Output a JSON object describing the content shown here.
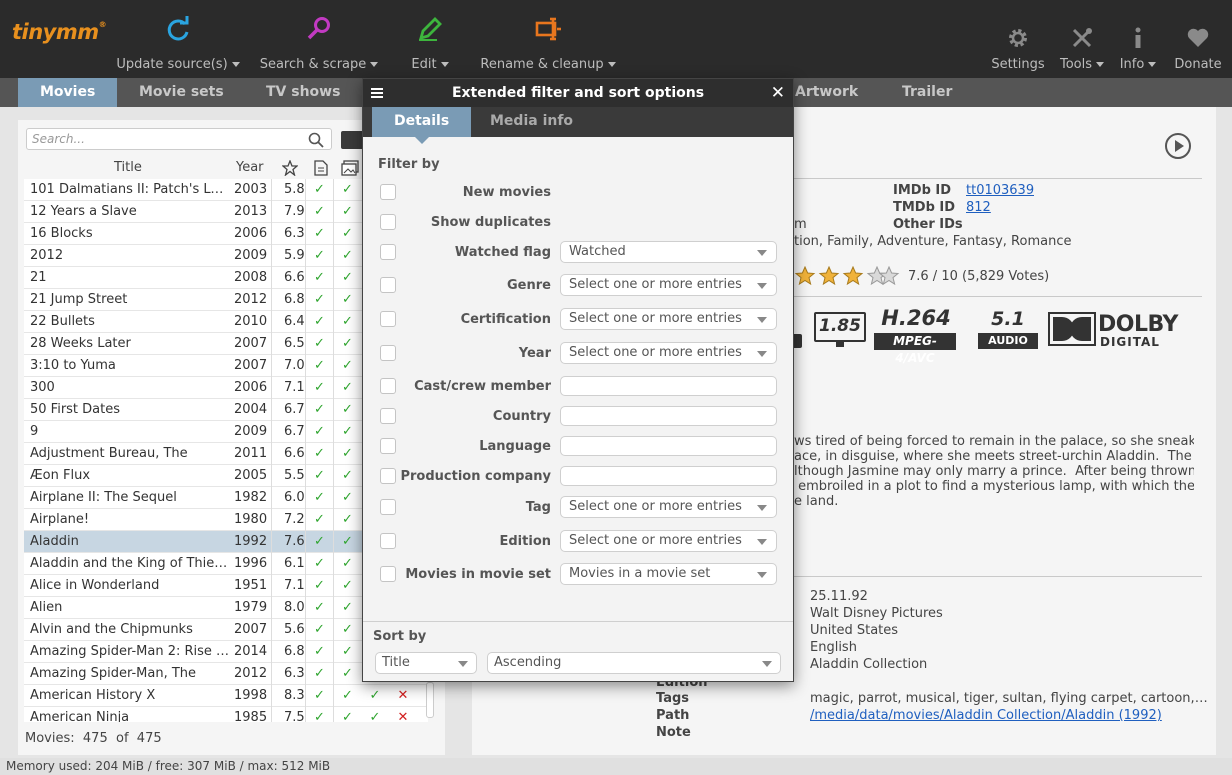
{
  "app": {
    "logo": "tinymm",
    "logo_mark": "®"
  },
  "toolbar": {
    "update": "Update source(s)",
    "search": "Search & scrape",
    "edit": "Edit",
    "rename": "Rename & cleanup",
    "settings": "Settings",
    "tools": "Tools",
    "info": "Info",
    "donate": "Donate"
  },
  "tabs": [
    "Movies",
    "Movie sets",
    "TV shows"
  ],
  "detail_tabs": {
    "artwork": "Artwork",
    "trailer": "Trailer"
  },
  "search": {
    "placeholder": "Search..."
  },
  "columns": {
    "title": "Title",
    "year": "Year"
  },
  "movies": [
    {
      "title": "101 Dalmatians II: Patch's Lo...",
      "year": "2003",
      "rating": "5.8"
    },
    {
      "title": "12 Years a Slave",
      "year": "2013",
      "rating": "7.9"
    },
    {
      "title": "16 Blocks",
      "year": "2006",
      "rating": "6.3"
    },
    {
      "title": "2012",
      "year": "2009",
      "rating": "5.9"
    },
    {
      "title": "21",
      "year": "2008",
      "rating": "6.6"
    },
    {
      "title": "21 Jump Street",
      "year": "2012",
      "rating": "6.8"
    },
    {
      "title": "22 Bullets",
      "year": "2010",
      "rating": "6.4"
    },
    {
      "title": "28 Weeks Later",
      "year": "2007",
      "rating": "6.5"
    },
    {
      "title": "3:10 to Yuma",
      "year": "2007",
      "rating": "7.0"
    },
    {
      "title": "300",
      "year": "2006",
      "rating": "7.1"
    },
    {
      "title": "50 First Dates",
      "year": "2004",
      "rating": "6.7"
    },
    {
      "title": "9",
      "year": "2009",
      "rating": "6.7"
    },
    {
      "title": "Adjustment Bureau, The",
      "year": "2011",
      "rating": "6.6"
    },
    {
      "title": "Æon Flux",
      "year": "2005",
      "rating": "5.5"
    },
    {
      "title": "Airplane II: The Sequel",
      "year": "1982",
      "rating": "6.0"
    },
    {
      "title": "Airplane!",
      "year": "1980",
      "rating": "7.2"
    },
    {
      "title": "Aladdin",
      "year": "1992",
      "rating": "7.6"
    },
    {
      "title": "Aladdin and the King of Thieves",
      "year": "1996",
      "rating": "6.1"
    },
    {
      "title": "Alice in Wonderland",
      "year": "1951",
      "rating": "7.1"
    },
    {
      "title": "Alien",
      "year": "1979",
      "rating": "8.0"
    },
    {
      "title": "Alvin and the Chipmunks",
      "year": "2007",
      "rating": "5.6"
    },
    {
      "title": "Amazing Spider-Man 2: Rise o...",
      "year": "2014",
      "rating": "6.8"
    },
    {
      "title": "Amazing Spider-Man, The",
      "year": "2012",
      "rating": "6.3"
    },
    {
      "title": "American History X",
      "year": "1998",
      "rating": "8.3"
    },
    {
      "title": "American Ninja",
      "year": "1985",
      "rating": "7.5"
    }
  ],
  "selected_movie": "Aladdin",
  "movies_count": {
    "label": "Movies:",
    "shown": "475",
    "of": "of",
    "total": "475"
  },
  "status": {
    "memory": "Memory used: 204 MiB  /  free: 307 MiB  /  max: 512 MiB"
  },
  "dialog": {
    "title": "Extended filter and sort options",
    "tab_details": "Details",
    "tab_media": "Media info",
    "filter_by": "Filter by",
    "filters": [
      {
        "label": "New movies"
      },
      {
        "label": "Show duplicates"
      },
      {
        "label": "Watched flag",
        "value": "Watched"
      },
      {
        "label": "Genre",
        "value": "Select one or more entries"
      },
      {
        "label": "Certification",
        "value": "Select one or more entries"
      },
      {
        "label": "Year",
        "value": "Select one or more entries"
      },
      {
        "label": "Cast/crew member",
        "value": ""
      },
      {
        "label": "Country",
        "value": ""
      },
      {
        "label": "Language",
        "value": ""
      },
      {
        "label": "Production company",
        "value": ""
      },
      {
        "label": "Tag",
        "value": "Select one or more entries"
      },
      {
        "label": "Edition",
        "value": "Select one or more entries"
      },
      {
        "label": "Movies in movie set",
        "value": "Movies in a movie set"
      }
    ],
    "sort_by": "Sort by",
    "sort_field": "Title",
    "sort_order": "Ascending"
  },
  "detail": {
    "imdb_label": "IMDb ID",
    "imdb_value": "tt0103639",
    "tmdb_label": "TMDb ID",
    "tmdb_value": "812",
    "other_label": "Other IDs",
    "fragment_m": "m",
    "genres_fragment": "tion, Family, Adventure, Fantasy, Romance",
    "rating": "7.6 / 10  (5,829 Votes)",
    "aspect": "1.85",
    "codec": "H.264",
    "codec_sub": "MPEG-4/AVC",
    "audio": "5.1",
    "audio_sub": "AUDIO",
    "dolby": "DOLBY",
    "dolby_sub": "DIGITAL",
    "plot_lines": [
      "ws tired of being forced to remain in the palace, so she sneaks",
      "ace, in disguise, where she meets street-urchin Aladdin.  The",
      "lthough Jasmine may only marry a prince.  After being thrown in",
      " embroiled in a plot to find a mysterious lamp, with which the evil",
      "e land."
    ],
    "release": "25.11.92",
    "production": "Walt Disney Pictures",
    "country": "United States",
    "language": "English",
    "collection": "Aladdin Collection",
    "edition_label": "Edition",
    "tags_label": "Tags",
    "tags": "magic, parrot, musical, tiger, sultan, flying carpet, cartoon, p...",
    "path_label": "Path",
    "path": "/media/data/movies/Aladdin Collection/Aladdin (1992)",
    "note_label": "Note"
  },
  "colors": {
    "accent": "#7a9bb5",
    "toolbar": "#2b2b2b",
    "check": "#2fa52f",
    "cross": "#d21f1f",
    "logo": "#e8901e"
  }
}
